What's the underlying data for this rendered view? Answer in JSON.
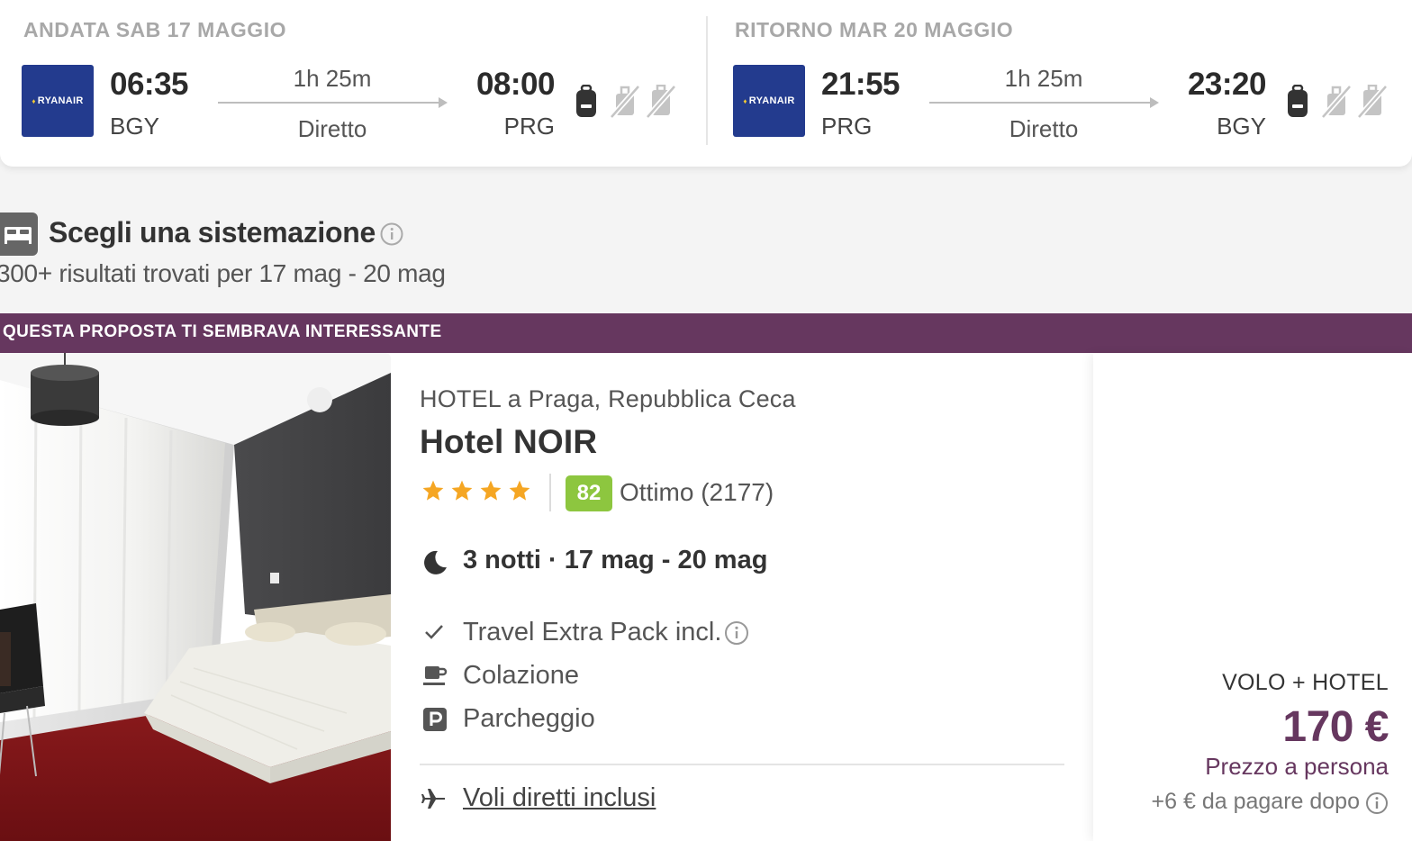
{
  "flights": {
    "outbound": {
      "date_label": "ANDATA SAB 17 MAGGIO",
      "airline": "RYANAIR",
      "departure_time": "06:35",
      "departure_airport": "BGY",
      "duration": "1h 25m",
      "stops": "Diretto",
      "arrival_time": "08:00",
      "arrival_airport": "PRG"
    },
    "return": {
      "date_label": "RITORNO MAR 20 MAGGIO",
      "airline": "RYANAIR",
      "departure_time": "21:55",
      "departure_airport": "PRG",
      "duration": "1h 25m",
      "stops": "Diretto",
      "arrival_time": "23:20",
      "arrival_airport": "BGY"
    },
    "baggage_icons": [
      "personal-bag-icon",
      "cabin-bag-excluded-icon",
      "checked-bag-excluded-icon"
    ]
  },
  "accommodation": {
    "title": "Scegli una sistemazione",
    "results": "300+ risultati trovati per 17 mag - 20 mag"
  },
  "promo": {
    "label": "QUESTA PROPOSTA TI SEMBRAVA INTERESSANTE",
    "color": "#66375f"
  },
  "hotel": {
    "type_location": "HOTEL a Praga, Repubblica Ceca",
    "name": "Hotel NOIR",
    "stars": 4,
    "score": "82",
    "score_text": "Ottimo (2177)",
    "score_color": "#8dc63f",
    "stay": "3 notti · 17 mag - 20 mag",
    "amenities": [
      {
        "icon": "check-icon",
        "label": "Travel Extra Pack incl."
      },
      {
        "icon": "coffee-cup-icon",
        "label": "Colazione"
      },
      {
        "icon": "parking-icon",
        "label": "Parcheggio"
      }
    ],
    "flights_included": "Voli diretti inclusi"
  },
  "price": {
    "kind": "VOLO + HOTEL",
    "amount": "170 €",
    "per_person": "Prezzo a persona",
    "extra": "+6 € da pagare dopo"
  }
}
